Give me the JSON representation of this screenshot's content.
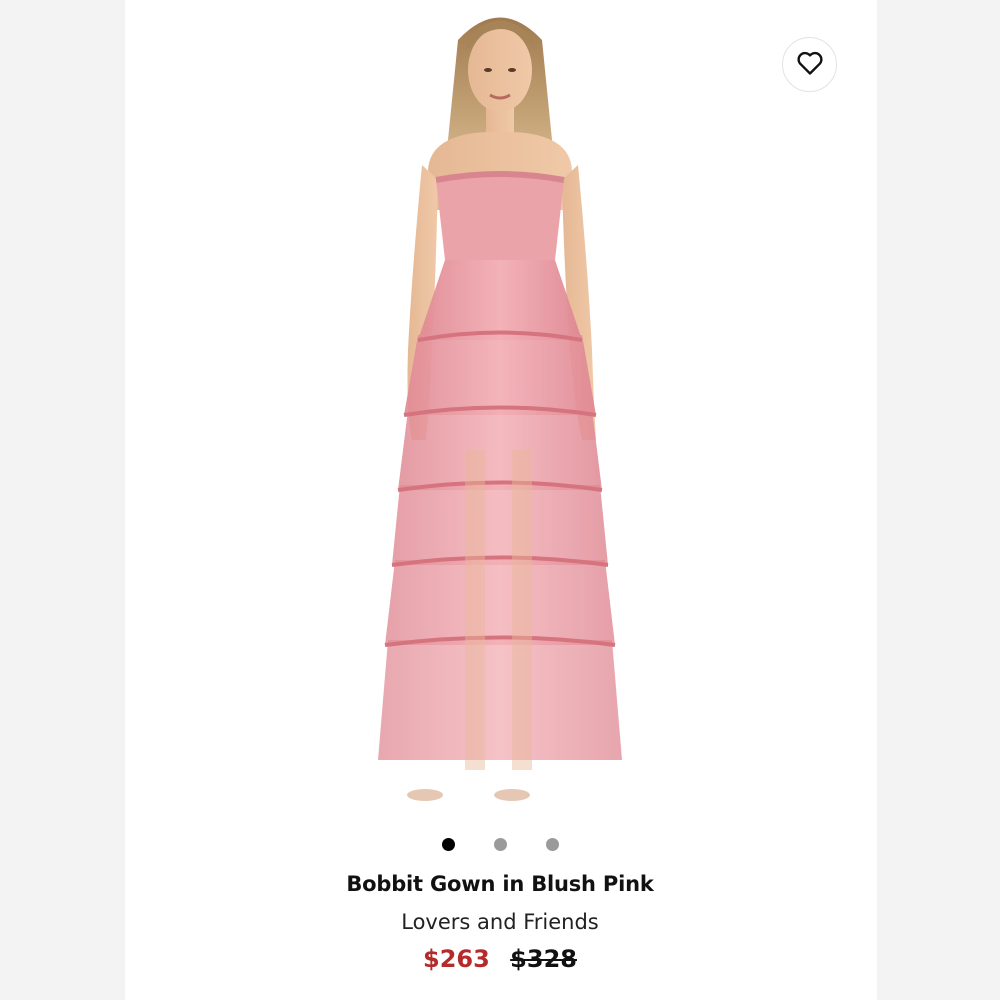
{
  "product": {
    "image_alt": "Model wearing tiered pink tulle strapless gown",
    "name": "Bobbit Gown in Blush Pink",
    "brand": "Lovers and Friends",
    "sale_price": "$263",
    "original_price": "$328"
  },
  "wishlist": {
    "icon": "heart-icon"
  },
  "carousel": {
    "total": 3,
    "active_index": 0
  },
  "colors": {
    "sale_price": "#b52a2a",
    "dress": "#e7959e",
    "dot_active": "#000000",
    "dot_inactive": "#9a9a9a"
  }
}
